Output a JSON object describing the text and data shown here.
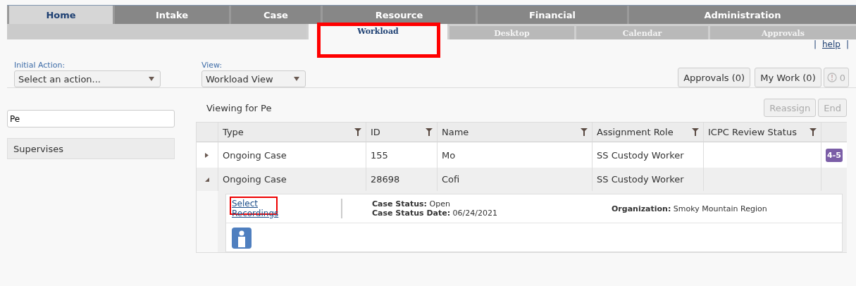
{
  "main_tabs": [
    {
      "label": "Home",
      "selected": true
    },
    {
      "label": "Intake",
      "selected": false
    },
    {
      "label": "Case",
      "selected": false
    },
    {
      "label": "Resource",
      "selected": false
    },
    {
      "label": "Financial",
      "selected": false
    },
    {
      "label": "Administration",
      "selected": false
    }
  ],
  "sub_tabs": [
    {
      "label": "Workload",
      "selected": true,
      "highlighted": true
    },
    {
      "label": "Desktop",
      "selected": false,
      "highlighted": false
    },
    {
      "label": "Calendar",
      "selected": false,
      "highlighted": false
    },
    {
      "label": "Approvals",
      "selected": false,
      "highlighted": false
    }
  ],
  "help_link": "help",
  "help_separators": [
    "|",
    "|"
  ],
  "initial_action": {
    "label": "Initial Action:",
    "value": "Select an action..."
  },
  "view": {
    "label": "View:",
    "value": "Workload View"
  },
  "top_buttons": [
    {
      "label": "Approvals (0)",
      "disabled": false
    },
    {
      "label": "My Work (0)",
      "disabled": false
    }
  ],
  "alerts": {
    "count": "0",
    "disabled": true
  },
  "search": {
    "value": "Pe"
  },
  "sidebar": {
    "items": [
      {
        "label": "Supervises"
      }
    ]
  },
  "viewing_for": "Viewing for Pe",
  "actions": [
    {
      "label": "Reassign",
      "disabled": true
    },
    {
      "label": "End",
      "disabled": true
    }
  ],
  "table": {
    "columns": [
      "Type",
      "ID",
      "Name",
      "Assignment Role",
      "ICPC Review Status"
    ],
    "rows": [
      {
        "expanded": false,
        "cells": [
          "Ongoing Case",
          "155",
          "Mo",
          "SS Custody Worker"
        ],
        "badge": {
          "text": "4-5",
          "color": "#7b5ea7"
        }
      },
      {
        "expanded": true,
        "cells": [
          "Ongoing Case",
          "28698",
          "Cofi",
          "SS Custody Worker"
        ],
        "detail": {
          "links": [
            {
              "label": "Select",
              "highlighted": true
            },
            {
              "label": "Recordings",
              "highlighted": false
            }
          ],
          "fields": [
            {
              "label": "Case Status:",
              "value": "Open"
            },
            {
              "label": "Case Status Date:",
              "value": "06/24/2021"
            },
            {
              "label": "Organization:",
              "value": "Smoky Mountain Region"
            }
          ]
        }
      }
    ]
  }
}
